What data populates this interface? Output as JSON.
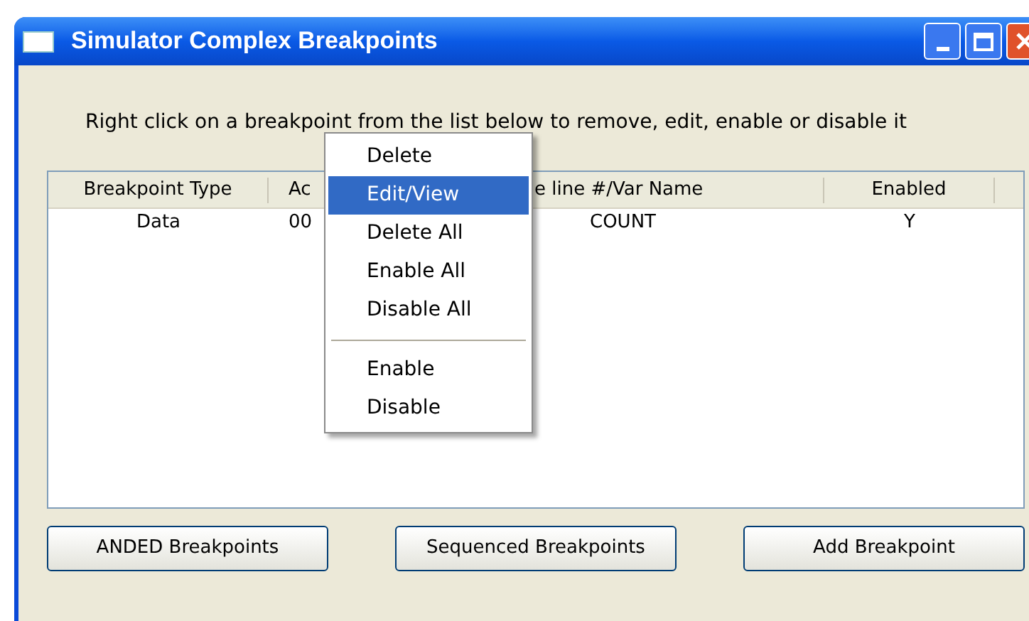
{
  "window": {
    "title": "Simulator Complex Breakpoints"
  },
  "instruction": "Right click on a breakpoint from the list below to remove, edit, enable or disable it",
  "table": {
    "columns": [
      "Breakpoint Type",
      "Ac",
      "e line #/Var Name",
      "Enabled"
    ],
    "rows": [
      [
        "Data",
        "00",
        "COUNT",
        "Y"
      ]
    ]
  },
  "context_menu": [
    {
      "kind": "item",
      "label": "Delete",
      "selected": false
    },
    {
      "kind": "item",
      "label": "Edit/View",
      "selected": true
    },
    {
      "kind": "item",
      "label": "Delete All",
      "selected": false
    },
    {
      "kind": "item",
      "label": "Enable All",
      "selected": false
    },
    {
      "kind": "item",
      "label": "Disable All",
      "selected": false
    },
    {
      "kind": "separator"
    },
    {
      "kind": "item",
      "label": "Enable",
      "selected": false
    },
    {
      "kind": "item",
      "label": "Disable",
      "selected": false
    }
  ],
  "buttons": [
    "ANDED Breakpoints",
    "Sequenced Breakpoints",
    "Add Breakpoint"
  ]
}
